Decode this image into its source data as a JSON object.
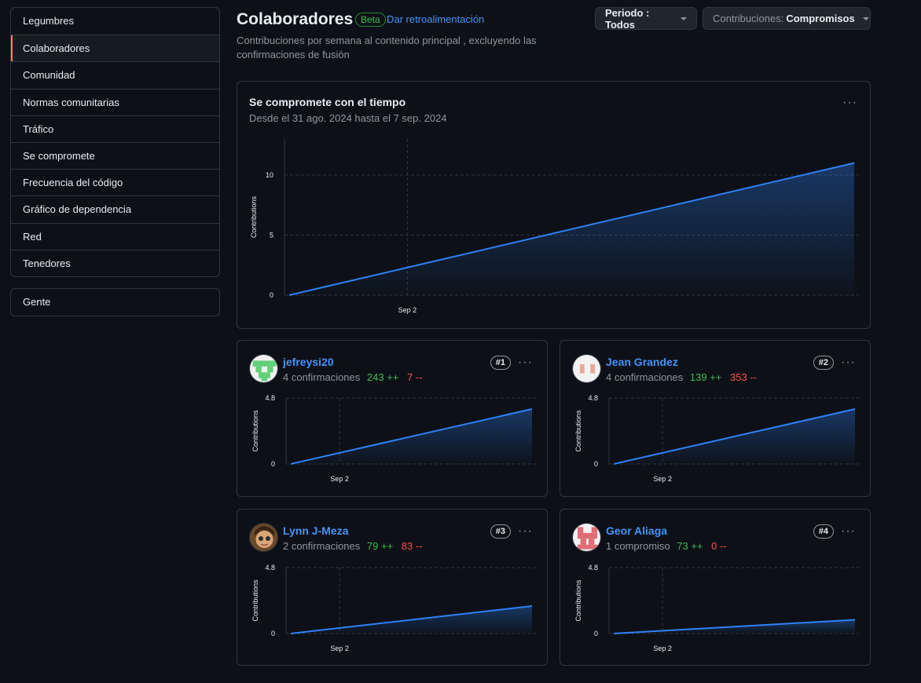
{
  "sidebar": {
    "items": [
      "Legumbres",
      "Colaboradores",
      "Comunidad",
      "Normas comunitarias",
      "Tráfico",
      "Se compromete",
      "Frecuencia del código",
      "Gráfico de dependencia",
      "Red",
      "Tenedores"
    ],
    "active_index": 1,
    "people": "Gente"
  },
  "header": {
    "title": "Colaboradores",
    "beta": "Beta",
    "feedback": "Dar retroalimentación",
    "subtitle": "Contribuciones por semana al contenido principal , excluyendo las confirmaciones de fusión"
  },
  "controls": {
    "period_label": "Periodo : Todos",
    "contrib_prefix": "Contribuciones: ",
    "contrib_value": "Compromisos"
  },
  "overview": {
    "title": "Se compromete con el tiempo",
    "subtitle": "Desde el 31 ago. 2024 hasta el 7 sep. 2024",
    "kebab": "···"
  },
  "colors": {
    "line": "#2f81f7",
    "grid": "#30363d",
    "additions": "#3fb950",
    "deletions": "#f85149"
  },
  "chart_data": [
    {
      "type": "area",
      "ylabel": "Contributions",
      "ylim": [
        0,
        13
      ],
      "yticks": [
        0,
        5,
        10
      ],
      "xticks": [
        {
          "label": "Sep 2",
          "x": 1.5
        }
      ],
      "xlim": [
        0,
        7
      ],
      "x": [
        0,
        7
      ],
      "series": [
        {
          "values": [
            0,
            11
          ]
        }
      ],
      "grid": true
    },
    {
      "type": "area",
      "ylabel": "Contributions",
      "ylim": [
        0,
        4.8
      ],
      "yticks": [
        0,
        4.8
      ],
      "xticks": [
        {
          "label": "Sep 2",
          "x": 1.5
        }
      ],
      "xlim": [
        0,
        7
      ],
      "x": [
        0,
        7
      ],
      "series": [
        {
          "values": [
            0,
            4
          ]
        }
      ],
      "grid": true
    },
    {
      "type": "area",
      "ylabel": "Contributions",
      "ylim": [
        0,
        4.8
      ],
      "yticks": [
        0,
        4.8
      ],
      "xticks": [
        {
          "label": "Sep 2",
          "x": 1.5
        }
      ],
      "xlim": [
        0,
        7
      ],
      "x": [
        0,
        7
      ],
      "series": [
        {
          "values": [
            0,
            4
          ]
        }
      ],
      "grid": true
    },
    {
      "type": "area",
      "ylabel": "Contributions",
      "ylim": [
        0,
        4.8
      ],
      "yticks": [
        0,
        4.8
      ],
      "xticks": [
        {
          "label": "Sep 2",
          "x": 1.5
        }
      ],
      "xlim": [
        0,
        7
      ],
      "x": [
        0,
        7
      ],
      "series": [
        {
          "values": [
            0,
            2
          ]
        }
      ],
      "grid": true
    },
    {
      "type": "area",
      "ylabel": "Contributions",
      "ylim": [
        0,
        4.8
      ],
      "yticks": [
        0,
        4.8
      ],
      "xticks": [
        {
          "label": "Sep 2",
          "x": 1.5
        }
      ],
      "xlim": [
        0,
        7
      ],
      "x": [
        0,
        7
      ],
      "series": [
        {
          "values": [
            0,
            1
          ]
        }
      ],
      "grid": true
    }
  ],
  "contributors": [
    {
      "name": "jefreysi20",
      "commits": "4 confirmaciones",
      "additions": "243 ++",
      "deletions": "7 --",
      "rank": "#1",
      "kebab": "···",
      "avatar_icon": "identicon-green-icon"
    },
    {
      "name": "Jean Grandez",
      "commits": "4 confirmaciones",
      "additions": "139 ++",
      "deletions": "353 --",
      "rank": "#2",
      "kebab": "···",
      "avatar_icon": "identicon-pink-icon"
    },
    {
      "name": "Lynn J-Meza",
      "commits": "2 confirmaciones",
      "additions": "79 ++",
      "deletions": "83 --",
      "rank": "#3",
      "kebab": "···",
      "avatar_icon": "photo-avatar-icon"
    },
    {
      "name": "Geor Aliaga",
      "commits": "1 compromiso",
      "additions": "73 ++",
      "deletions": "0 --",
      "rank": "#4",
      "kebab": "···",
      "avatar_icon": "identicon-red-icon"
    }
  ]
}
